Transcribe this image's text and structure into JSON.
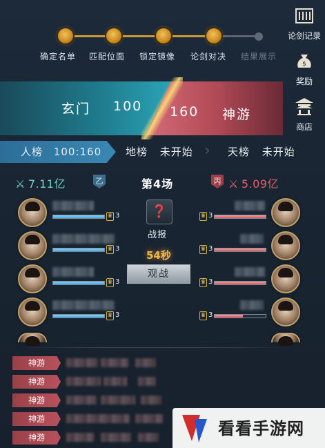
{
  "steps": [
    {
      "label": "确定名单",
      "done": true
    },
    {
      "label": "匹配位面",
      "done": true
    },
    {
      "label": "锁定镜像",
      "done": true
    },
    {
      "label": "论剑对决",
      "done": true
    },
    {
      "label": "结果展示",
      "done": false
    }
  ],
  "side_menu": {
    "record": "论剑记录",
    "reward": "奖励",
    "shop": "商店"
  },
  "matchup": {
    "left_team": "玄门",
    "left_score": "100",
    "right_score": "160",
    "right_team": "神游"
  },
  "tabs": [
    {
      "name": "人榜",
      "status": "100:160"
    },
    {
      "name": "地榜",
      "status": "未开始"
    },
    {
      "name": "天榜",
      "status": "未开始"
    }
  ],
  "battle": {
    "left_power": "7.11亿",
    "left_group": "乙",
    "round_title": "第4场",
    "right_group": "丙",
    "right_power": "5.09亿",
    "report_label": "战报",
    "timer": "54秒",
    "watch_button": "观战"
  },
  "left_players": [
    {
      "star": "3",
      "hp": 1.0
    },
    {
      "star": "3",
      "hp": 1.0
    },
    {
      "star": "3",
      "hp": 1.0
    },
    {
      "star": "3",
      "hp": 1.0
    }
  ],
  "right_players": [
    {
      "star": "3",
      "hp": 1.0
    },
    {
      "star": "3",
      "hp": 1.0
    },
    {
      "star": "3",
      "hp": 1.0
    },
    {
      "star": "3",
      "hp": 0.55
    }
  ],
  "log_rows": [
    "神游",
    "神游",
    "神游",
    "神游",
    "神游"
  ],
  "watermark": "看看手游网",
  "colors": {
    "accent_gold": "#c89a3a",
    "blue_team": "#2ba3b5",
    "red_team": "#b34b57",
    "power_left": "#6fd3c6",
    "power_right": "#e0606a"
  }
}
